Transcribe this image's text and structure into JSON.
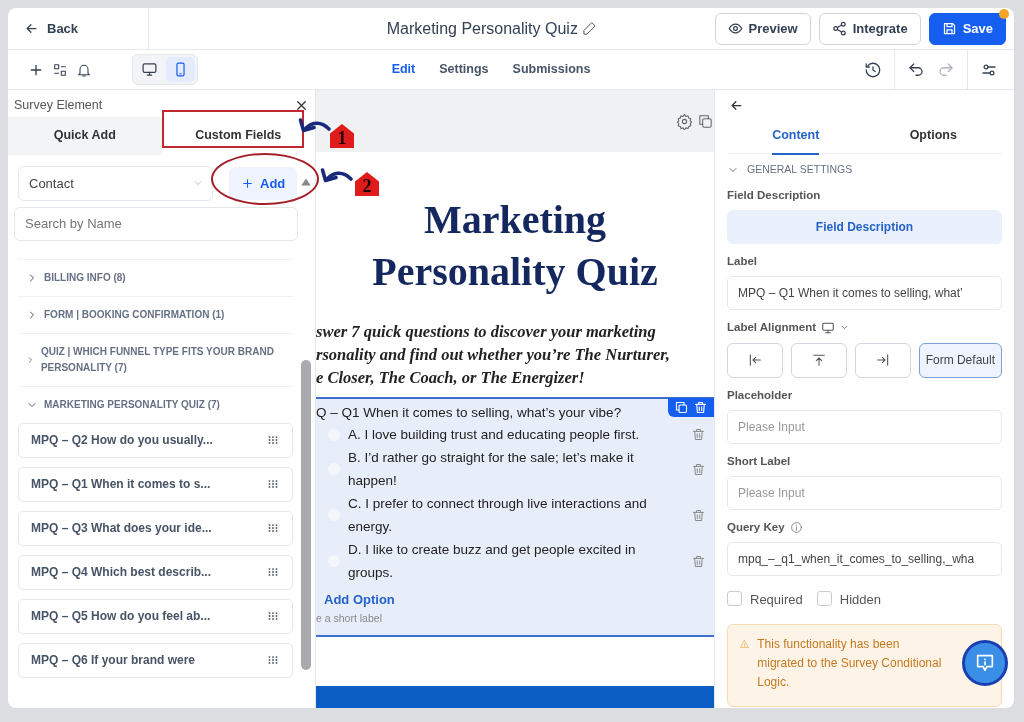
{
  "header": {
    "back": "Back",
    "title": "Marketing Personality Quiz",
    "buttons": [
      {
        "label": "Preview",
        "kind": "preview"
      },
      {
        "label": "Integrate",
        "kind": "integrate"
      },
      {
        "label": "Save",
        "kind": "save"
      }
    ]
  },
  "toolbar": {
    "devices": [
      {
        "kind": "desktop",
        "selected": false
      },
      {
        "kind": "mobile",
        "selected": true
      }
    ],
    "tabs": [
      {
        "label": "Edit",
        "selected": true
      },
      {
        "label": "Settings",
        "selected": false
      },
      {
        "label": "Submissions",
        "selected": false
      }
    ]
  },
  "left_panel": {
    "title": "Survey Element",
    "tabs": [
      {
        "label": "Quick Add",
        "selected": false
      },
      {
        "label": "Custom Fields",
        "selected": true
      }
    ],
    "object_select": {
      "value": "Contact"
    },
    "add_button": "Add",
    "search": {
      "placeholder": "Search by Name"
    },
    "groups": [
      {
        "label": "BILLING INFO (8)",
        "expanded": false
      },
      {
        "label": "FORM | BOOKING CONFIRMATION (1)",
        "expanded": false
      },
      {
        "label": "QUIZ | WHICH FUNNEL TYPE FITS YOUR BRAND PERSONALITY  (7)",
        "expanded": false
      },
      {
        "label": "MARKETING PERSONALITY QUIZ (7)",
        "expanded": true,
        "items": [
          "MPQ – Q2 How do you usually...",
          "MPQ – Q1 When it comes to s...",
          "MPQ – Q3 What does your ide...",
          "MPQ – Q4 Which best describ...",
          "MPQ – Q5 How do you feel ab...",
          "MPQ – Q6 If your brand were"
        ]
      }
    ]
  },
  "canvas": {
    "title": "Marketing Personality Quiz",
    "description_lines": [
      "swer 7 quick questions to discover your marketing",
      "rsonality and find out whether you’re The Nurturer,",
      "e Closer, The Coach, or The Energizer!"
    ],
    "question": {
      "label": "Q – Q1 When it comes to selling, what’s your vibe?",
      "options": [
        {
          "text": "A. I love building trust and educating people first.",
          "selected": false
        },
        {
          "text": "B. I’d rather go straight for the sale; let’s make it happen!",
          "selected": false
        },
        {
          "text": "C. I prefer to connect through live interactions and energy.",
          "selected": false
        },
        {
          "text": "D. I like to create buzz and get people excited in groups.",
          "selected": false
        }
      ],
      "add_option": "Add Option",
      "hint": "e a short label"
    }
  },
  "right_panel": {
    "tabs": [
      {
        "label": "Content",
        "selected": true
      },
      {
        "label": "Options",
        "selected": false
      }
    ],
    "section": {
      "label": "GENERAL SETTINGS",
      "expanded": true
    },
    "field_description": {
      "label": "Field Description",
      "button": "Field Description"
    },
    "label_field": {
      "label": "Label",
      "value": "MPQ – Q1 When it comes to selling, what’"
    },
    "alignment": {
      "label": "Label Alignment",
      "options": [
        {
          "kind": "left",
          "selected": false
        },
        {
          "kind": "top",
          "selected": false
        },
        {
          "kind": "right",
          "selected": false
        },
        {
          "kind": "default",
          "label": "Form Default",
          "selected": true
        }
      ]
    },
    "placeholder_field": {
      "label": "Placeholder",
      "placeholder": "Please Input"
    },
    "short_label_field": {
      "label": "Short Label",
      "placeholder": "Please Input"
    },
    "query_key_field": {
      "label": "Query Key",
      "value": "mpq_–_q1_when_it_comes_to_selling,_wha"
    },
    "checkboxes": [
      {
        "label": "Required",
        "checked": false
      },
      {
        "label": "Hidden",
        "checked": false
      }
    ],
    "warning": "This functionality has been migrated to the Survey Conditional Logic."
  },
  "annotations": [
    {
      "number": "1",
      "kind": "box"
    },
    {
      "number": "2",
      "kind": "ellipse"
    }
  ]
}
